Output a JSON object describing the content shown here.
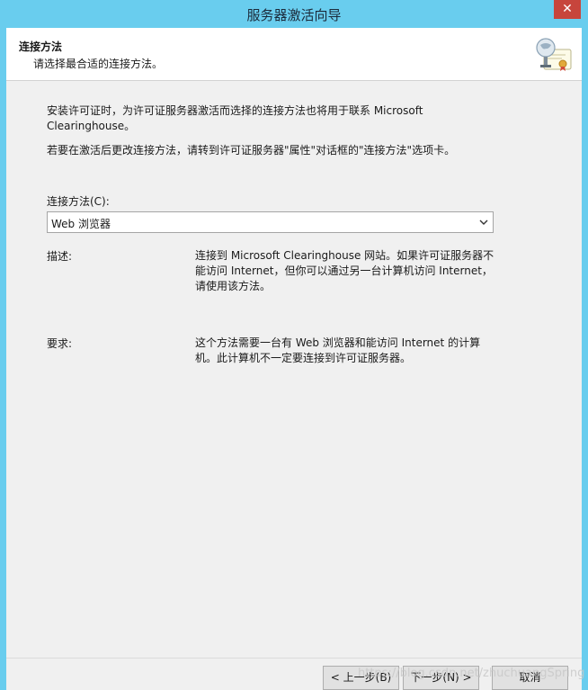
{
  "window": {
    "title": "服务器激活向导",
    "close_label": "✕"
  },
  "header": {
    "title": "连接方法",
    "subtitle": "请选择最合适的连接方法。",
    "icon": "license-certificate-icon"
  },
  "body": {
    "intro_line1": "安装许可证时，为许可证服务器激活而选择的连接方法也将用于联系 Microsoft",
    "intro_line2": "Clearinghouse。",
    "note": "若要在激活后更改连接方法，请转到许可证服务器\"属性\"对话框的\"连接方法\"选项卡。",
    "connection_label": "连接方法(C):",
    "connection_value": "Web 浏览器",
    "description_label": "描述:",
    "description_line1": "连接到 Microsoft Clearinghouse 网站。如果许可证服务器不",
    "description_line2": "能访问 Internet，但你可以通过另一台计算机访问 Internet，",
    "description_line3": "请使用该方法。",
    "requirement_label": "要求:",
    "requirement_line1": "这个方法需要一台有 Web 浏览器和能访问 Internet 的计算",
    "requirement_line2": "机。此计算机不一定要连接到许可证服务器。"
  },
  "footer": {
    "back_label": "< 上一步(B)",
    "next_label": "下一步(N) >",
    "cancel_label": "取消"
  },
  "watermark": "https://blog.csdn.net/zhuchuangSpring",
  "colors": {
    "titlebar": "#69cdee",
    "close": "#c7453c",
    "panel": "#f0f0f0"
  }
}
